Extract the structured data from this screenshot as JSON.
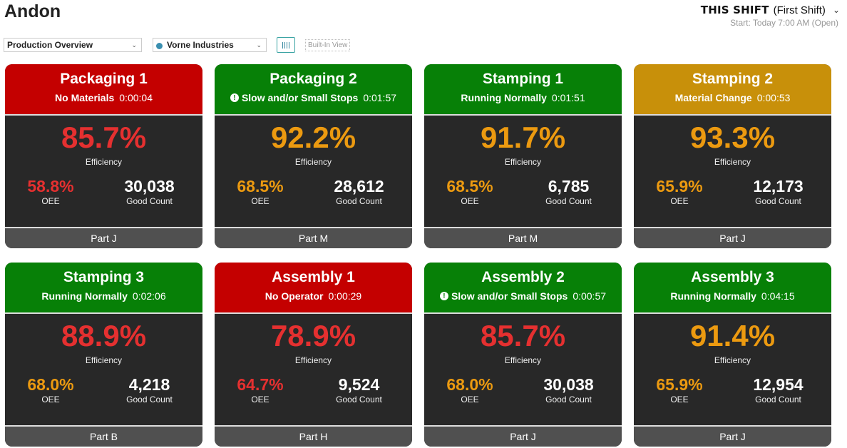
{
  "app": {
    "title": "Andon"
  },
  "shift": {
    "name": "THIS SHIFT",
    "sub": "(First Shift)",
    "start": "Start: Today 7:00 AM (Open)"
  },
  "toolbar": {
    "view_select": "Production Overview",
    "site_select": "Vorne Industries",
    "builtin_label": "Built-In View"
  },
  "labels": {
    "efficiency": "Efficiency",
    "oee": "OEE",
    "good_count": "Good Count"
  },
  "colors": {
    "red_header": "#c40000",
    "green_header": "#078007",
    "amber_header": "#c8900a",
    "red_metric": "#e53030",
    "amber_metric": "#ec9a10",
    "white_metric": "#ffffff"
  },
  "tiles": [
    {
      "name": "Packaging 1",
      "reason": "No Materials",
      "duration": "0:00:04",
      "warn": false,
      "state": "red",
      "efficiency": "85.7%",
      "efficiency_color": "red",
      "oee": "58.8%",
      "oee_color": "red",
      "good_count": "30,038",
      "part": "Part J"
    },
    {
      "name": "Packaging 2",
      "reason": "Slow and/or Small Stops",
      "duration": "0:01:57",
      "warn": true,
      "state": "green",
      "efficiency": "92.2%",
      "efficiency_color": "amber",
      "oee": "68.5%",
      "oee_color": "amber",
      "good_count": "28,612",
      "part": "Part M"
    },
    {
      "name": "Stamping 1",
      "reason": "Running Normally",
      "duration": "0:01:51",
      "warn": false,
      "state": "green",
      "efficiency": "91.7%",
      "efficiency_color": "amber",
      "oee": "68.5%",
      "oee_color": "amber",
      "good_count": "6,785",
      "part": "Part M"
    },
    {
      "name": "Stamping 2",
      "reason": "Material Change",
      "duration": "0:00:53",
      "warn": false,
      "state": "amber",
      "efficiency": "93.3%",
      "efficiency_color": "amber",
      "oee": "65.9%",
      "oee_color": "amber",
      "good_count": "12,173",
      "part": "Part J"
    },
    {
      "name": "Stamping 3",
      "reason": "Running Normally",
      "duration": "0:02:06",
      "warn": false,
      "state": "green",
      "efficiency": "88.9%",
      "efficiency_color": "red",
      "oee": "68.0%",
      "oee_color": "amber",
      "good_count": "4,218",
      "part": "Part B"
    },
    {
      "name": "Assembly 1",
      "reason": "No Operator",
      "duration": "0:00:29",
      "warn": false,
      "state": "red",
      "efficiency": "78.9%",
      "efficiency_color": "red",
      "oee": "64.7%",
      "oee_color": "red",
      "good_count": "9,524",
      "part": "Part H"
    },
    {
      "name": "Assembly 2",
      "reason": "Slow and/or Small Stops",
      "duration": "0:00:57",
      "warn": true,
      "state": "green",
      "efficiency": "85.7%",
      "efficiency_color": "red",
      "oee": "68.0%",
      "oee_color": "amber",
      "good_count": "30,038",
      "part": "Part J"
    },
    {
      "name": "Assembly 3",
      "reason": "Running Normally",
      "duration": "0:04:15",
      "warn": false,
      "state": "green",
      "efficiency": "91.4%",
      "efficiency_color": "amber",
      "oee": "65.9%",
      "oee_color": "amber",
      "good_count": "12,954",
      "part": "Part J"
    }
  ]
}
